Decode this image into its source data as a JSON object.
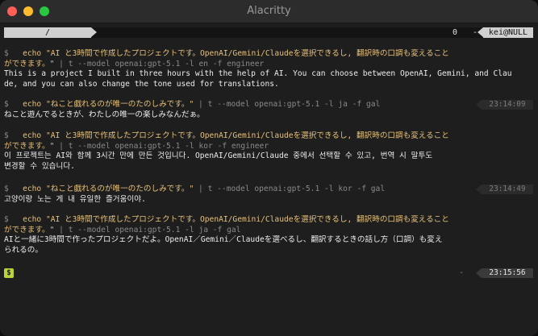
{
  "window": {
    "title": "Alacritty"
  },
  "statusbar": {
    "path": "/",
    "count": "0",
    "dash": "-",
    "user": "kei@NULL"
  },
  "blocks": [
    {
      "prompt": "$",
      "cmd_a": "echo \"AI と3時間で作成したプロジェクトです。OpenAI/Gemini/Claudeを選択できるし, 翻訳時の口調も変えること",
      "cmd_b": "ができます。\"",
      "pipe": " | t --model openai:gpt-5.1 -l en -f engineer",
      "out1": "This is a project I built in three hours with the help of AI. You can choose between OpenAI, Gemini, and Clau",
      "out2": "de, and you can also change the tone used for translations."
    },
    {
      "prompt": "$",
      "cmd": "echo \"ねこと戯れるのが唯一のたのしみです。\"",
      "pipe": " | t --model openai:gpt-5.1 -l ja -f gal",
      "out": "ねこと遊んでるときが、わたしの唯一の楽しみなんだぁ。",
      "time": "23:14:09"
    },
    {
      "prompt": "$",
      "cmd_a": "echo \"AI と3時間で作成したプロジェクトです。OpenAI/Gemini/Claudeを選択できるし, 翻訳時の口調も変えること",
      "cmd_b": "ができます。\"",
      "pipe": " | t --model openai:gpt-5.1 -l kor -f engineer",
      "out1": "이 프로젝트는 AI와 함께 3시간 만에 만든 것입니다. OpenAI/Gemini/Claude 중에서 선택할 수 있고, 번역 시 말투도",
      "out2": "변경할 수 있습니다."
    },
    {
      "prompt": "$",
      "cmd": "echo \"ねこと戯れるのが唯一のたのしみです。\"",
      "pipe": " | t --model openai:gpt-5.1 -l kor -f gal",
      "out": "고양이랑 노는 게 내 유일한 즐거움이야.",
      "time": "23:14:49"
    },
    {
      "prompt": "$",
      "cmd_a": "echo \"AI と3時間で作成したプロジェクトです。OpenAI/Gemini/Claudeを選択できるし, 翻訳時の口調も変えること",
      "cmd_b": "ができます。\"",
      "pipe": " | t --model openai:gpt-5.1 -l ja -f gal",
      "out1": "AIと一緒に3時間で作ったプロジェクトだよ。OpenAI／Gemini／Claudeを選べるし、翻訳するときの話し方（口調）も変え",
      "out2": "られるの。"
    }
  ],
  "final": {
    "prompt": "$",
    "dash": "-",
    "time": "23:15:56"
  }
}
